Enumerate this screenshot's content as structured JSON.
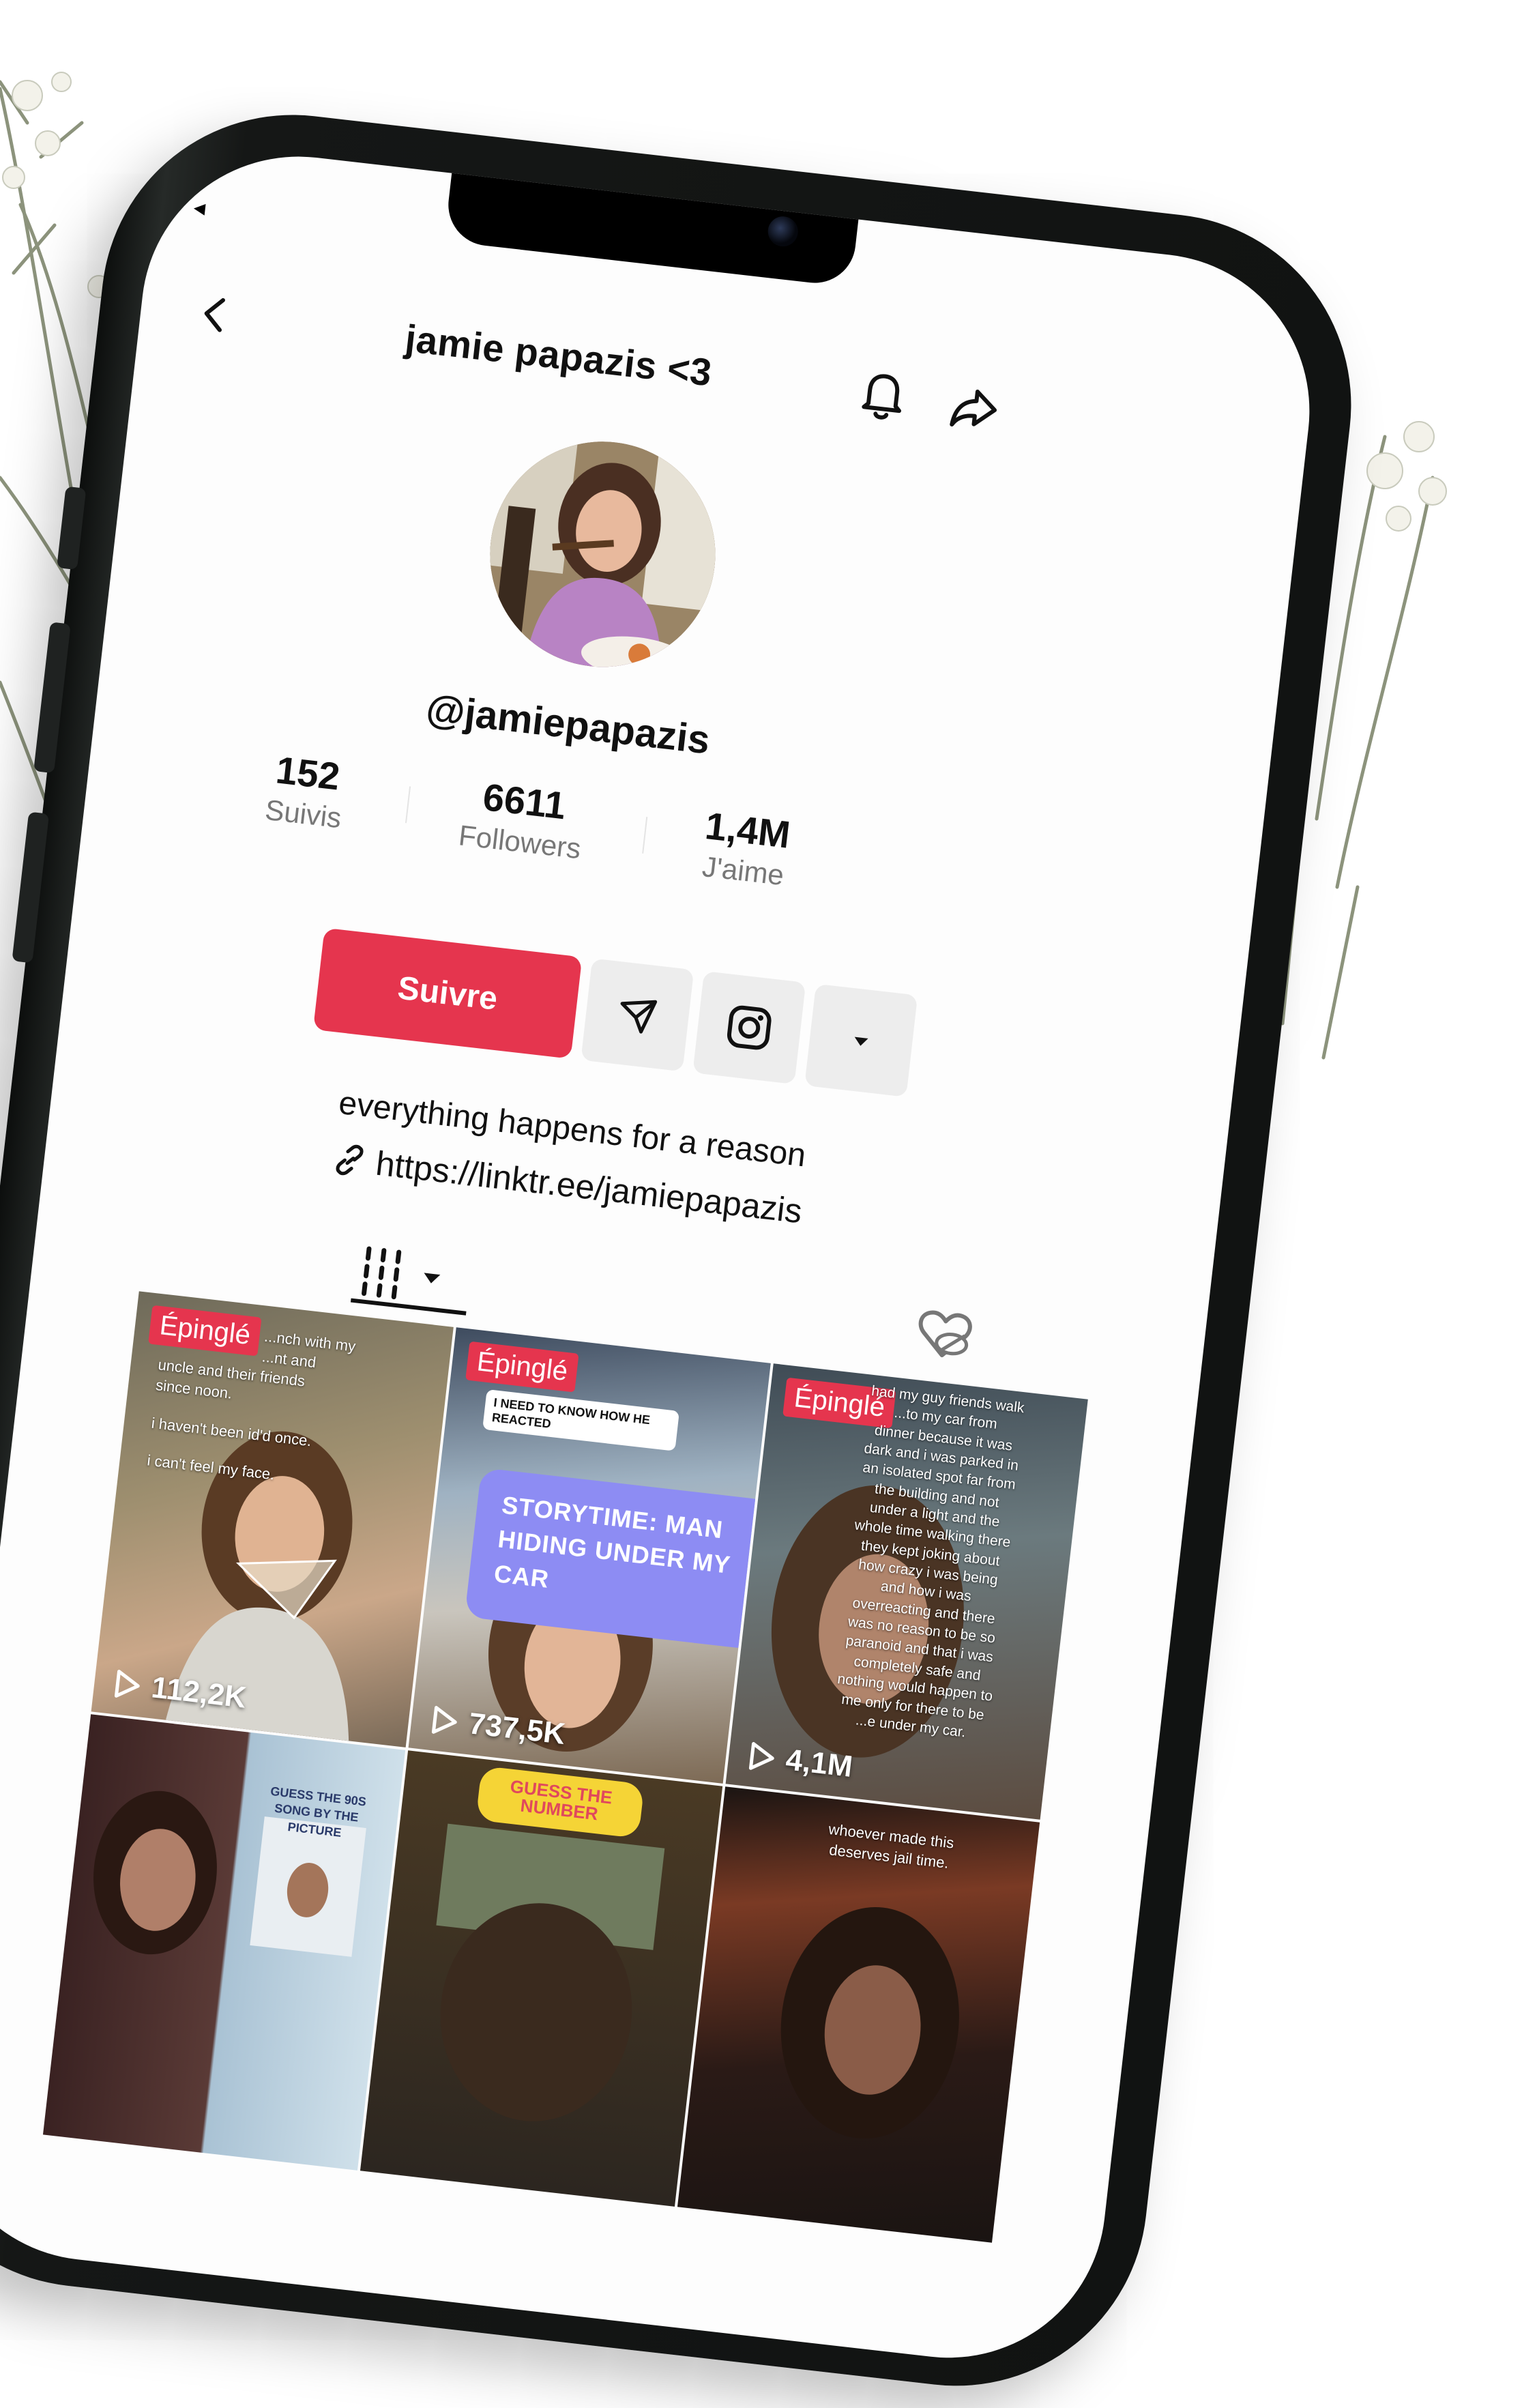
{
  "profile": {
    "display_name": "jamie papazis <3",
    "handle": "@jamiepapazis",
    "bio": "everything happens for a reason",
    "link": "https://linktr.ee/jamiepapazis"
  },
  "stats": [
    {
      "value": "152",
      "label": "Suivis"
    },
    {
      "value": "6611",
      "label": "Followers"
    },
    {
      "value": "1,4M",
      "label": "J'aime"
    }
  ],
  "actions": {
    "follow_label": "Suivre"
  },
  "videos": [
    {
      "pinned_label": "Épinglé",
      "views": "112,2K",
      "overlay": [
        "...nch with my",
        "...nt and",
        "uncle and their friends",
        "since noon.",
        "",
        "i haven't been id'd once.",
        "",
        "i can't feel my face."
      ]
    },
    {
      "pinned_label": "Épinglé",
      "views": "737,5K",
      "comment": "I NEED TO KNOW HOW HE REACTED",
      "card": "STORYTIME: MAN HIDING UNDER MY CAR"
    },
    {
      "pinned_label": "Épinglé",
      "views": "4,1M",
      "overlay": [
        "had my guy friends walk",
        "...to my car from",
        "dinner because it was",
        "dark and i was parked in",
        "an isolated spot far from",
        "the building and not",
        "under a light and the",
        "whole time walking there",
        "they kept joking about",
        "how crazy i was being",
        "and how i was",
        "overreacting and there",
        "was no reason to be so",
        "paranoid and that i was",
        "completely safe and",
        "nothing would happen to",
        "me only for there to be",
        "...e under my car."
      ]
    },
    {
      "overlay_title": "GUESS THE 90S SONG BY THE PICTURE"
    },
    {
      "pill": "GUESS THE NUMBER"
    },
    {
      "overlay": [
        "whoever made this",
        "deserves jail time."
      ]
    }
  ],
  "colors": {
    "accent": "#e5354e",
    "button_bg": "#ededed",
    "purple_card": "#8d8cf3",
    "yellow_pill": "#f5d436"
  }
}
